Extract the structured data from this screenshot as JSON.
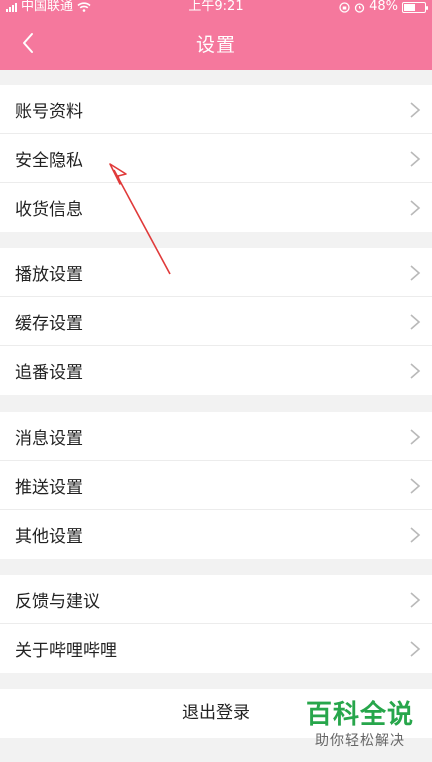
{
  "status_bar": {
    "carrier": "中国联通",
    "time": "上午9:21",
    "battery": "48%",
    "battery_level": 0.48
  },
  "nav": {
    "title": "设置",
    "back_icon": "chevron-left-icon"
  },
  "groups": [
    {
      "items": [
        {
          "label": "账号资料"
        },
        {
          "label": "安全隐私"
        },
        {
          "label": "收货信息"
        }
      ]
    },
    {
      "items": [
        {
          "label": "播放设置"
        },
        {
          "label": "缓存设置"
        },
        {
          "label": "追番设置"
        }
      ]
    },
    {
      "items": [
        {
          "label": "消息设置"
        },
        {
          "label": "推送设置"
        },
        {
          "label": "其他设置"
        }
      ]
    },
    {
      "items": [
        {
          "label": "反馈与建议"
        },
        {
          "label": "关于哔哩哔哩"
        }
      ]
    }
  ],
  "logout_label": "退出登录",
  "watermark": {
    "title": "百科全说",
    "subtitle": "助你轻松解决"
  },
  "colors": {
    "accent": "#f5789d",
    "annotation": "#e03a3a",
    "watermark_green": "#27a64b"
  }
}
